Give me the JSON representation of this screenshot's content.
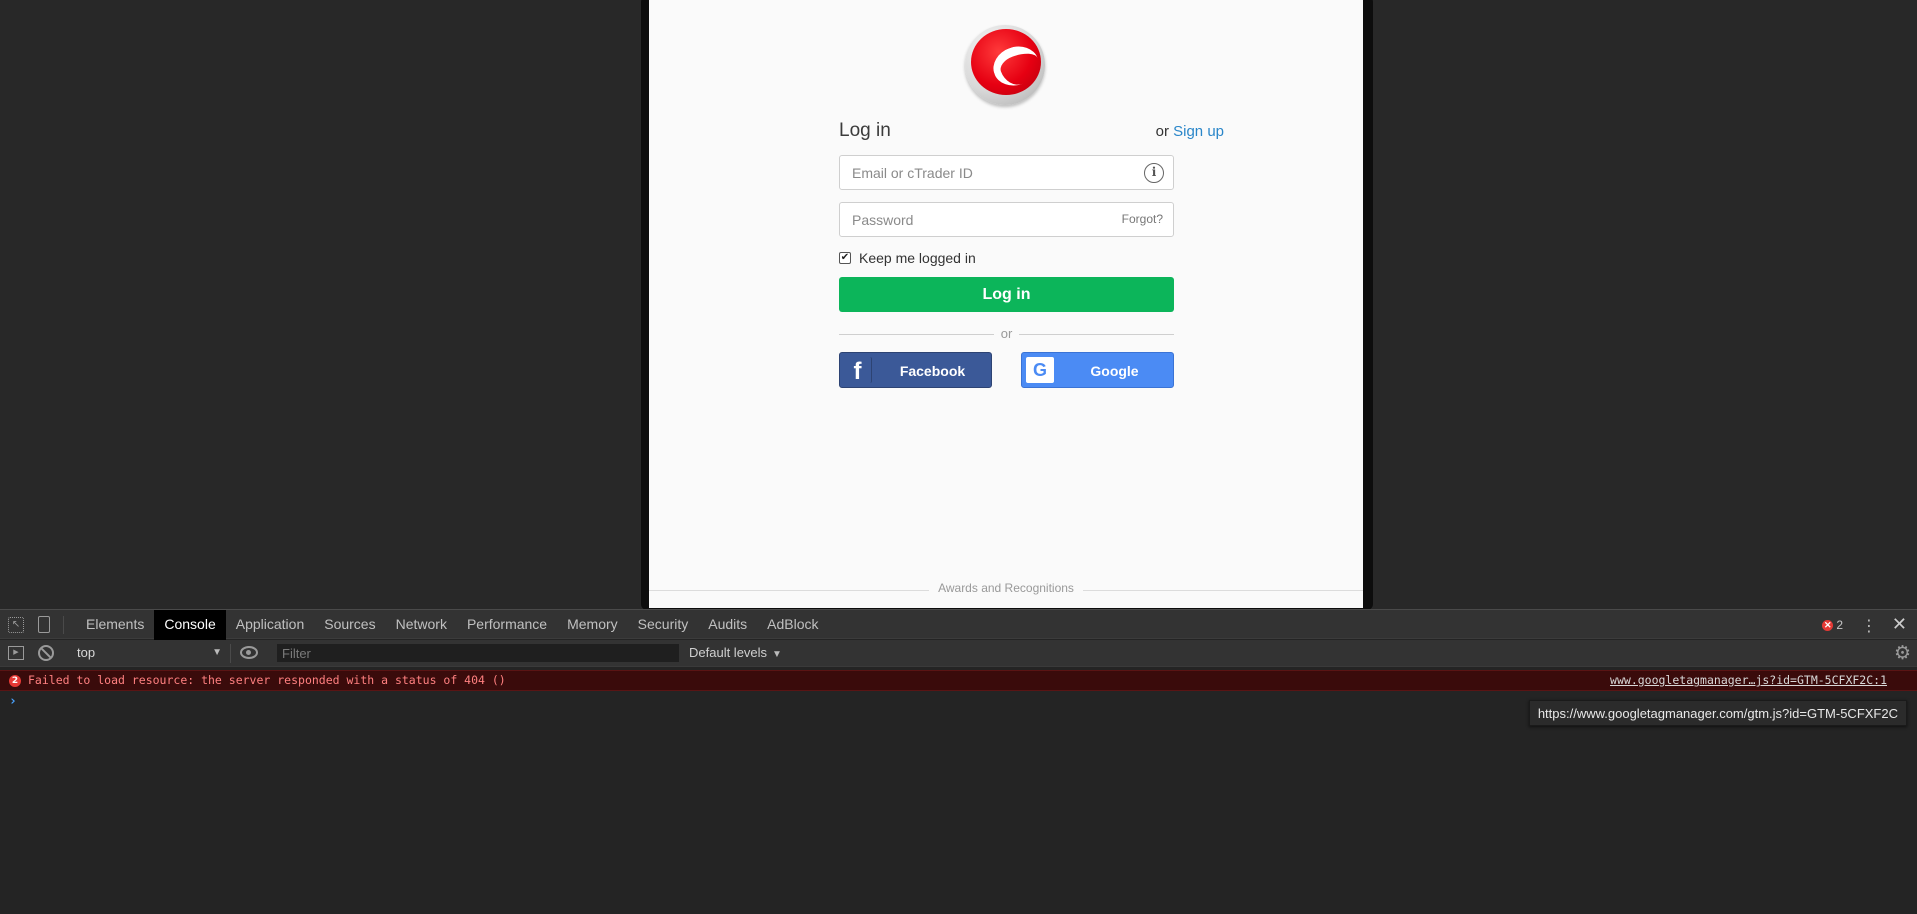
{
  "login": {
    "title": "Log in",
    "or_text": "or",
    "signup_link": "Sign up",
    "email_placeholder": "Email or cTrader ID",
    "info_icon_glyph": "i",
    "password_placeholder": "Password",
    "forgot_link": "Forgot?",
    "keep_logged_in_label": "Keep me logged in",
    "keep_logged_in_checked": true,
    "login_button": "Log in",
    "divider_text": "or",
    "facebook_button": "Facebook",
    "google_button": "Google",
    "awards_text": "Awards and Recognitions"
  },
  "devtools": {
    "tabs": [
      "Elements",
      "Console",
      "Application",
      "Sources",
      "Network",
      "Performance",
      "Memory",
      "Security",
      "Audits",
      "AdBlock"
    ],
    "active_tab": "Console",
    "error_count": "2",
    "context": "top",
    "filter_placeholder": "Filter",
    "levels": "Default levels",
    "console_messages": [
      {
        "level": "error",
        "count": "2",
        "message": "Failed to load resource: the server responded with a status of 404 ()",
        "source": "www.googletagmanager…js?id=GTM-5CFXF2C:1"
      }
    ],
    "prompt_glyph": "›",
    "tooltip": "https://www.googletagmanager.com/gtm.js?id=GTM-5CFXF2C"
  },
  "colors": {
    "login_button": "#0cb55a",
    "facebook": "#3b5998",
    "google": "#4b8bf4",
    "link": "#2a86c9",
    "error_text": "#ff8080",
    "error_bg": "#3a0b0b"
  },
  "icons": {
    "logo": "ctrader-logo-icon",
    "info": "info-icon",
    "facebook": "facebook-icon",
    "google": "google-icon",
    "inspect": "inspect-element-icon",
    "device": "device-toolbar-icon",
    "more": "more-vertical-icon",
    "close": "close-icon",
    "sidebar": "sidebar-toggle-icon",
    "clear": "clear-console-icon",
    "eye": "eye-icon",
    "settings": "gear-icon",
    "error": "error-icon"
  }
}
